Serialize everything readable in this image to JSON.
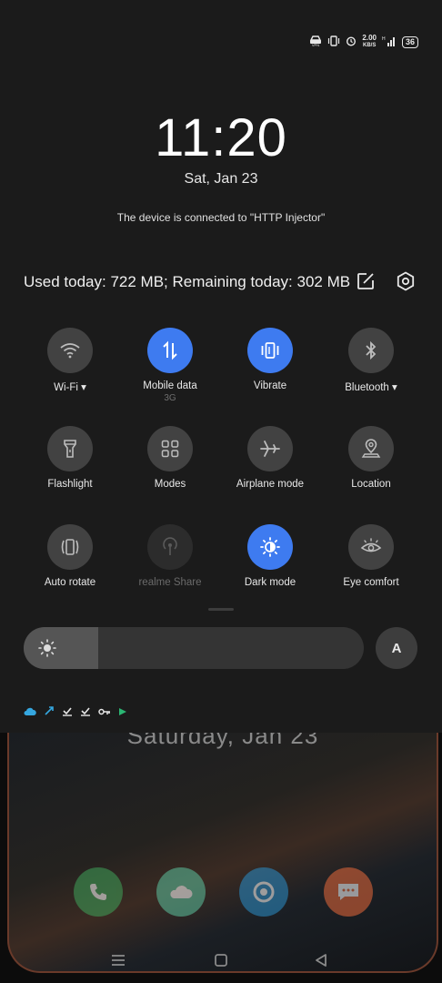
{
  "status_bar": {
    "speed_value": "2.00",
    "speed_unit": "KB/S",
    "battery": "36"
  },
  "lock": {
    "time": "11:20",
    "date": "Sat, Jan 23",
    "vpn_notice": "The device is connected to \"HTTP Injector\""
  },
  "data_usage": {
    "text": "Used today: 722 MB; Remaining today: 302 MB"
  },
  "tiles": [
    {
      "label": "Wi-Fi ▾",
      "state": "off",
      "icon": "wifi-icon"
    },
    {
      "label": "Mobile data",
      "sub": "3G",
      "state": "on",
      "icon": "mobile-data-icon"
    },
    {
      "label": "Vibrate",
      "state": "on",
      "icon": "vibrate-icon"
    },
    {
      "label": "Bluetooth ▾",
      "state": "off",
      "icon": "bluetooth-icon"
    },
    {
      "label": "Flashlight",
      "state": "off",
      "icon": "flashlight-icon"
    },
    {
      "label": "Modes",
      "state": "off",
      "icon": "modes-icon"
    },
    {
      "label": "Airplane mode",
      "state": "off",
      "icon": "airplane-icon"
    },
    {
      "label": "Location",
      "state": "off",
      "icon": "location-icon"
    },
    {
      "label": "Auto rotate",
      "state": "off",
      "icon": "auto-rotate-icon"
    },
    {
      "label": "realme Share",
      "state": "disabled",
      "icon": "share-icon"
    },
    {
      "label": "Dark mode",
      "state": "on",
      "icon": "dark-mode-icon"
    },
    {
      "label": "Eye comfort",
      "state": "off",
      "icon": "eye-comfort-icon"
    }
  ],
  "brightness": {
    "level": 0.22,
    "auto_label": "A"
  },
  "wallpaper": {
    "date": "Saturday, Jan 23"
  },
  "colors": {
    "accent": "#3e7bf0",
    "panel_bg": "#1b1b1b",
    "tile_off": "#424242"
  }
}
